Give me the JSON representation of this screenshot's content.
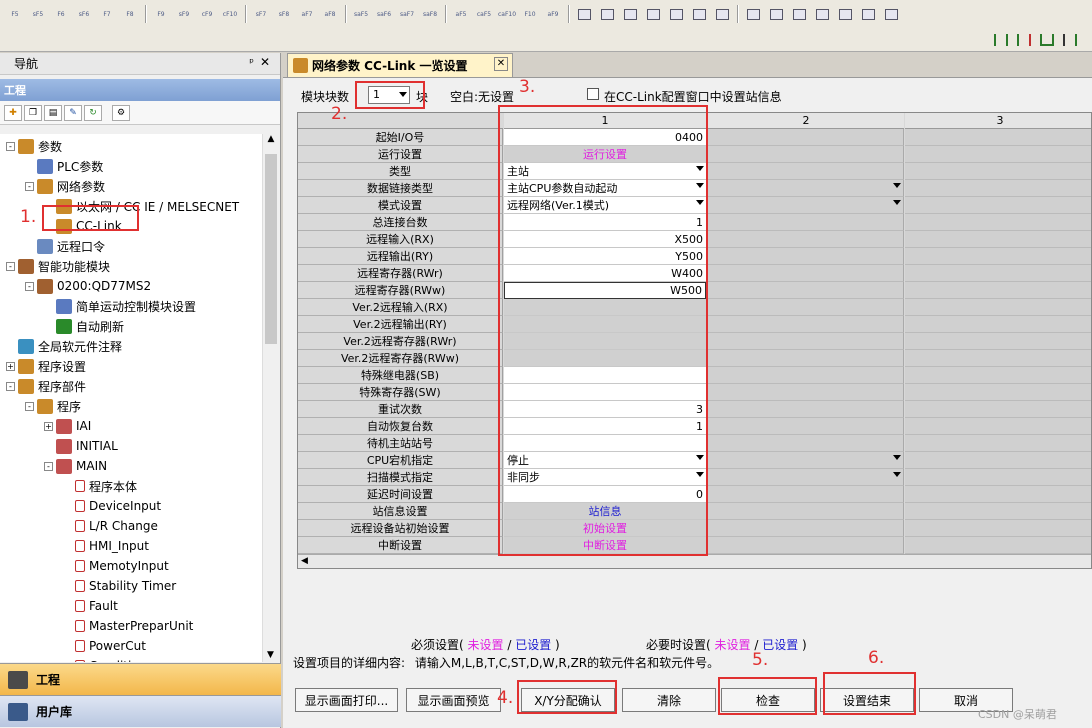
{
  "toolbar": {
    "row1": [
      "F5",
      "sF5",
      "F6",
      "sF6",
      "F7",
      "F8",
      "F9",
      "sF9",
      "cF9",
      "cF10",
      "sF7",
      "sF8",
      "aF7",
      "aF8",
      "saF5",
      "saF6",
      "saF7",
      "saF8",
      "aF5",
      "caF5",
      "caF10",
      "F10",
      "aF9"
    ],
    "row2_icons": [
      "ladder-icon",
      "ladder-icon",
      "ladder-icon",
      "ladder-icon"
    ]
  },
  "nav": {
    "title": "导航",
    "pin": "ᵖ",
    "close": "✕",
    "project_bar": "工程",
    "tree": [
      {
        "label": "参数",
        "level": 0,
        "exp": "-"
      },
      {
        "label": "PLC参数",
        "level": 1
      },
      {
        "label": "网络参数",
        "level": 1,
        "exp": "-"
      },
      {
        "label": "以太网 / CC IE / MELSECNET",
        "level": 2
      },
      {
        "label": "CC-Link",
        "level": 2
      },
      {
        "label": "远程口令",
        "level": 1
      },
      {
        "label": "智能功能模块",
        "level": 0,
        "exp": "-"
      },
      {
        "label": "0200:QD77MS2",
        "level": 1,
        "exp": "-"
      },
      {
        "label": "简单运动控制模块设置",
        "level": 2
      },
      {
        "label": "自动刷新",
        "level": 2
      },
      {
        "label": "全局软元件注释",
        "level": 0
      },
      {
        "label": "程序设置",
        "level": 0,
        "exp": "+"
      },
      {
        "label": "程序部件",
        "level": 0,
        "exp": "-"
      },
      {
        "label": "程序",
        "level": 1,
        "exp": "-"
      },
      {
        "label": "IAI",
        "level": 2,
        "exp": "+"
      },
      {
        "label": "INITIAL",
        "level": 2
      },
      {
        "label": "MAIN",
        "level": 2,
        "exp": "-"
      },
      {
        "label": "程序本体",
        "level": 3
      },
      {
        "label": "DeviceInput",
        "level": 3
      },
      {
        "label": "L/R Change",
        "level": 3
      },
      {
        "label": "HMI_Input",
        "level": 3
      },
      {
        "label": "MemotyInput",
        "level": 3
      },
      {
        "label": "Stability Timer",
        "level": 3
      },
      {
        "label": "Fault",
        "level": 3
      },
      {
        "label": "MasterPreparUnit",
        "level": 3
      },
      {
        "label": "PowerCut",
        "level": 3
      },
      {
        "label": "Condition",
        "level": 3
      }
    ],
    "bottom_tabs": [
      "工程",
      "用户库"
    ]
  },
  "doc": {
    "tab_title": "网络参数  CC-Link 一览设置",
    "module_count_label": "模块块数",
    "module_count_value": "1",
    "module_unit": "块",
    "blank_hint": "空白:无设置",
    "checkbox_label": "在CC-Link配置窗口中设置站信息"
  },
  "grid": {
    "columns": [
      "1",
      "2",
      "3"
    ],
    "rows": [
      {
        "label": "起始I/O号",
        "value": "0400",
        "kind": "num"
      },
      {
        "label": "运行设置",
        "value": "运行设置",
        "kind": "link"
      },
      {
        "label": "类型",
        "value": "主站",
        "kind": "dd"
      },
      {
        "label": "数据链接类型",
        "value": "主站CPU参数自动起动",
        "kind": "dd"
      },
      {
        "label": "模式设置",
        "value": "远程网络(Ver.1模式)",
        "kind": "dd"
      },
      {
        "label": "总连接台数",
        "value": "1",
        "kind": "num"
      },
      {
        "label": "远程输入(RX)",
        "value": "X500",
        "kind": "num"
      },
      {
        "label": "远程输出(RY)",
        "value": "Y500",
        "kind": "num"
      },
      {
        "label": "远程寄存器(RWr)",
        "value": "W400",
        "kind": "num"
      },
      {
        "label": "远程寄存器(RWw)",
        "value": "W500",
        "kind": "num"
      },
      {
        "label": "Ver.2远程输入(RX)",
        "value": "",
        "kind": "gray"
      },
      {
        "label": "Ver.2远程输出(RY)",
        "value": "",
        "kind": "gray"
      },
      {
        "label": "Ver.2远程寄存器(RWr)",
        "value": "",
        "kind": "gray"
      },
      {
        "label": "Ver.2远程寄存器(RWw)",
        "value": "",
        "kind": "gray"
      },
      {
        "label": "特殊继电器(SB)",
        "value": "",
        "kind": "num"
      },
      {
        "label": "特殊寄存器(SW)",
        "value": "",
        "kind": "num"
      },
      {
        "label": "重试次数",
        "value": "3",
        "kind": "num"
      },
      {
        "label": "自动恢复台数",
        "value": "1",
        "kind": "num"
      },
      {
        "label": "待机主站站号",
        "value": "",
        "kind": "num"
      },
      {
        "label": "CPU宕机指定",
        "value": "停止",
        "kind": "dd"
      },
      {
        "label": "扫描模式指定",
        "value": "非同步",
        "kind": "dd"
      },
      {
        "label": "延迟时间设置",
        "value": "0",
        "kind": "num"
      },
      {
        "label": "站信息设置",
        "value": "站信息",
        "kind": "link_blue"
      },
      {
        "label": "远程设备站初始设置",
        "value": "初始设置",
        "kind": "link"
      },
      {
        "label": "中断设置",
        "value": "中断设置",
        "kind": "link"
      }
    ]
  },
  "legend": {
    "required_prefix": "必须设置(",
    "not_set": "未设置",
    "slash": " / ",
    "set": "已设置",
    "suffix": " )",
    "optional_prefix": "必要时设置(",
    "detail_label": "设置项目的详细内容:",
    "detail_text": "请输入M,L,B,T,C,ST,D,W,R,ZR的软元件名和软元件号。"
  },
  "buttons": [
    "显示画面打印...",
    "显示画面预览",
    "X/Y分配确认",
    "清除",
    "检查",
    "设置结束",
    "取消"
  ],
  "annotations": [
    "1.",
    "2.",
    "3.",
    "4.",
    "5.",
    "6."
  ],
  "watermark": "CSDN @呆萌君",
  "colors": {
    "accent_red": "#e03030",
    "link_magenta": "#e020e0",
    "link_blue": "#2020d0"
  }
}
